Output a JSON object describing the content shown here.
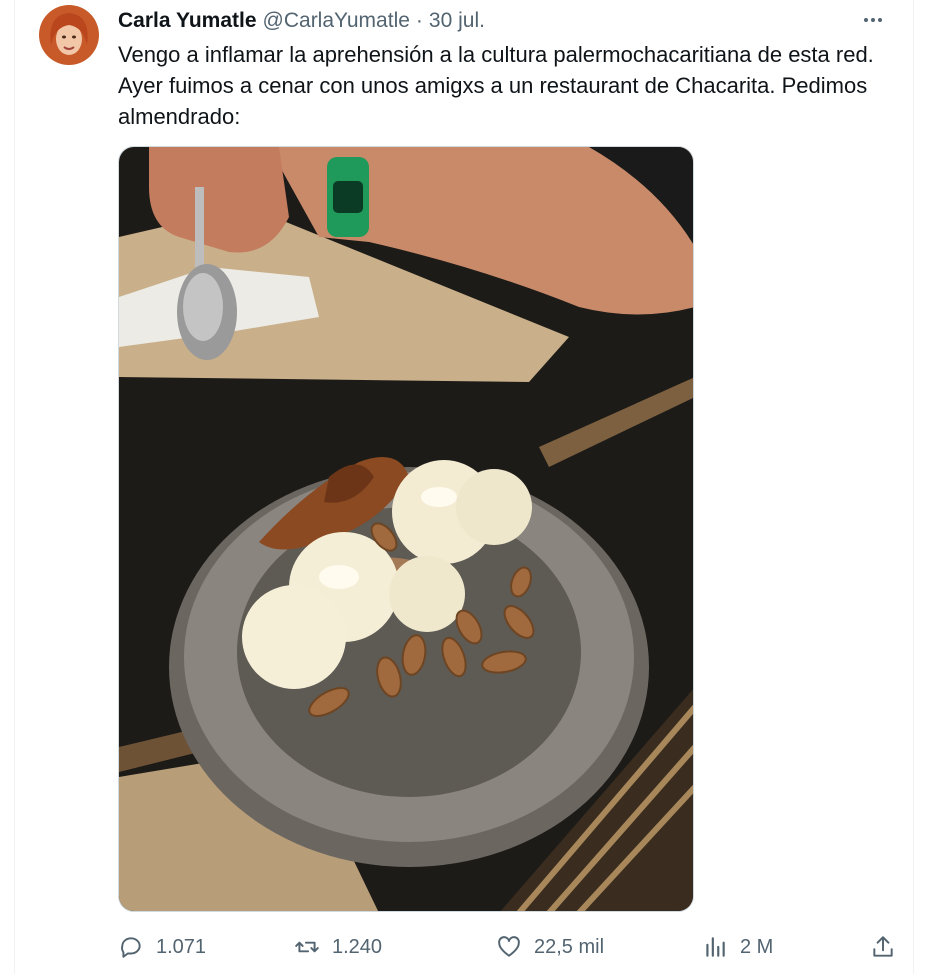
{
  "author": {
    "name": "Carla Yumatle",
    "handle": "@CarlaYumatle",
    "separator": "·",
    "date": "30 jul."
  },
  "tweet": {
    "text": "Vengo a inflamar la aprehensión a la cultura palermochacaritiana de esta red. Ayer fuimos a cenar con unos amigxs a un restaurant de Chacarita. Pedimos almendrado:"
  },
  "stats": {
    "replies": "1.071",
    "retweets": "1.240",
    "likes": "22,5 mil",
    "views": "2 M"
  },
  "icons": {
    "more": "more-horizontal-icon",
    "reply": "reply-icon",
    "retweet": "retweet-icon",
    "like": "heart-icon",
    "views": "views-icon",
    "share": "share-icon"
  },
  "colors": {
    "text": "#0f1419",
    "secondary": "#536471",
    "border": "#eff3f4"
  }
}
